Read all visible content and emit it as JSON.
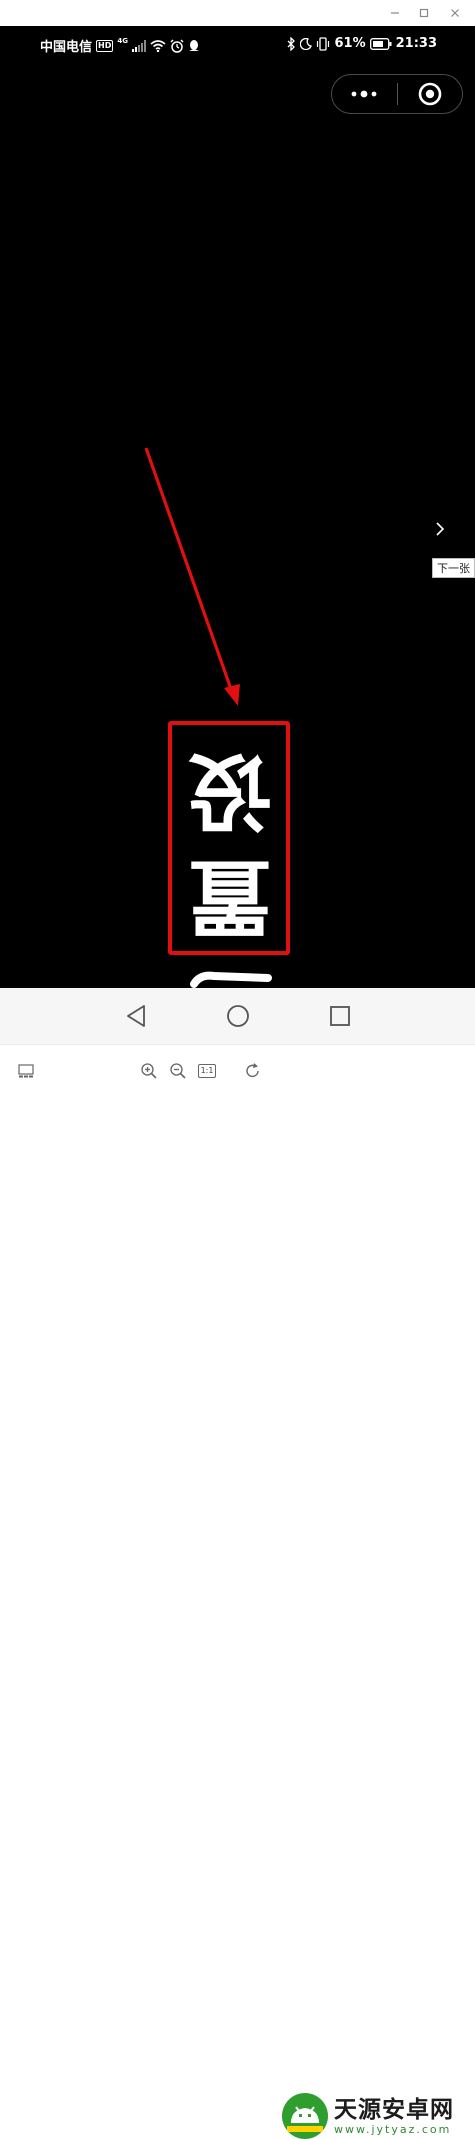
{
  "status_bar": {
    "carrier": "中国电信",
    "hd_badge": "HD",
    "network": "4G",
    "battery_percent": "61%",
    "time": "21:33"
  },
  "viewer": {
    "next_tooltip": "下一张"
  },
  "photo": {
    "rotated_characters": [
      "设",
      "置"
    ]
  },
  "toolbar": {
    "actual_size_label": "1:1"
  },
  "watermark": {
    "name_cn": "天源安卓网",
    "url": "www.jytyaz.com"
  },
  "colors": {
    "annotation_red": "#e01010",
    "brand_green": "#2e9e2e"
  }
}
